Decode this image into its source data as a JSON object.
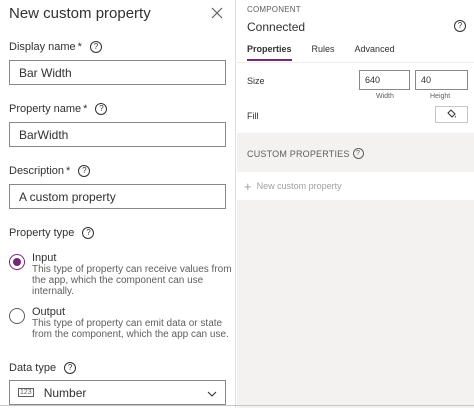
{
  "panel": {
    "title": "New custom property",
    "display_name": {
      "label": "Display name",
      "required": "*",
      "value": "Bar Width"
    },
    "property_name": {
      "label": "Property name",
      "required": "*",
      "value": "BarWidth"
    },
    "description": {
      "label": "Description",
      "required": "*",
      "value": "A custom property"
    },
    "property_type": {
      "label": "Property type",
      "options": [
        {
          "title": "Input",
          "desc": "This type of property can receive values from the app, which the component can use internally."
        },
        {
          "title": "Output",
          "desc": "This type of property can emit data or state from the component, which the app can use."
        }
      ],
      "selected": "Input"
    },
    "data_type": {
      "label": "Data type",
      "value": "Number",
      "icon_text": "123"
    }
  },
  "component": {
    "section_label": "COMPONENT",
    "name": "Connected",
    "tabs": [
      "Properties",
      "Rules",
      "Advanced"
    ],
    "active_tab": "Properties",
    "size_label": "Size",
    "width": "640",
    "width_label": "Width",
    "height": "40",
    "height_label": "Height",
    "fill_label": "Fill",
    "custom_props_label": "CUSTOM PROPERTIES",
    "new_prop_label": "New custom property"
  },
  "colors": {
    "accent": "#742774",
    "panel_bg": "#f3f2f1",
    "border": "#8a8886"
  }
}
